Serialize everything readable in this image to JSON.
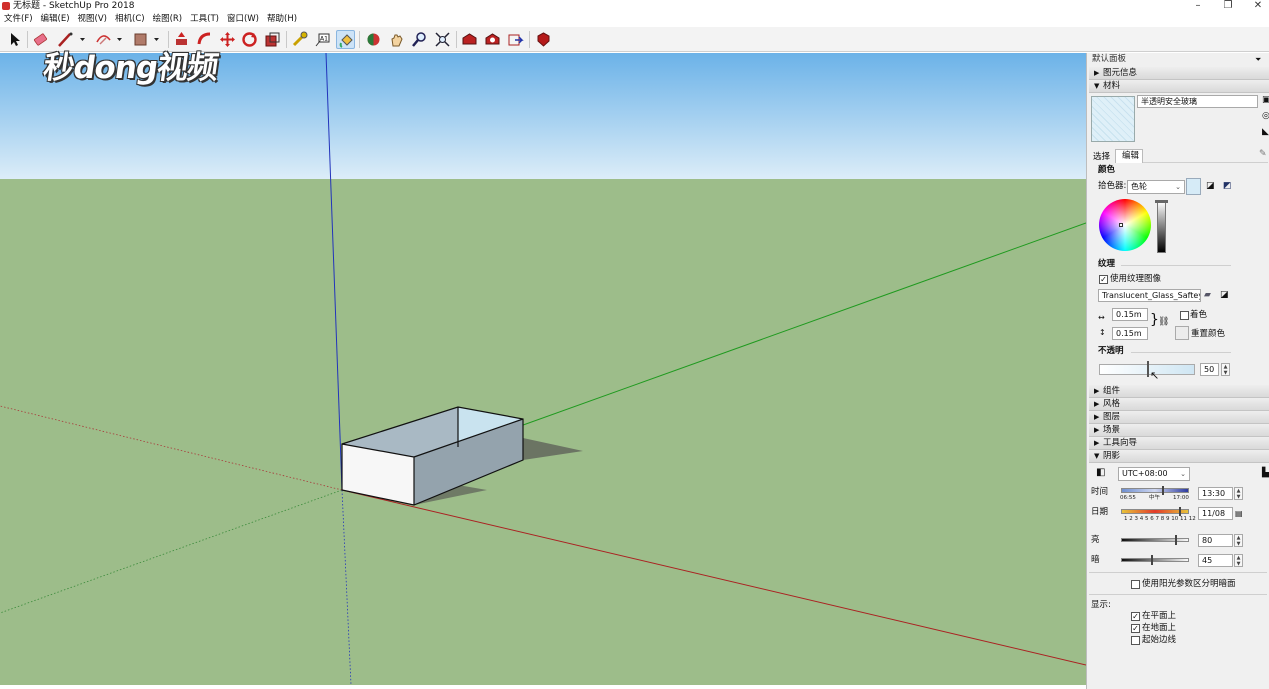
{
  "window": {
    "title": "无标题 - SketchUp Pro 2018",
    "minimize": "–",
    "maximize": "❐",
    "close": "✕"
  },
  "menu": [
    "文件(F)",
    "编辑(E)",
    "视图(V)",
    "相机(C)",
    "绘图(R)",
    "工具(T)",
    "窗口(W)",
    "帮助(H)"
  ],
  "toolbar": {
    "tools": [
      "select-tool",
      "eraser-tool",
      "line-tool",
      "arc-tool",
      "rectangle-tool",
      "pushpull-tool",
      "followme-tool",
      "move-tool",
      "rotate-tool",
      "scale-tool",
      "tape-measure-tool",
      "text-tool",
      "paint-bucket-tool",
      "orbit-tool",
      "pan-tool",
      "zoom-tool",
      "zoom-extents-tool",
      "warehouse-tool",
      "extension-warehouse-tool",
      "send-to-layout-tool",
      "ruby-console-tool"
    ],
    "active": "paint-bucket-tool"
  },
  "watermark": "秒dong视频",
  "panel": {
    "title": "默认面板",
    "sections_top": [
      "图元信息",
      "材料"
    ],
    "material": {
      "name": "半透明安全玻璃",
      "tabs": [
        "选择",
        "编辑"
      ],
      "active_tab": "编辑",
      "color_heading": "颜色",
      "picker_label": "拾色器:",
      "picker_value": "色轮",
      "color_swatch": "#d6ebf7",
      "texture_heading": "纹理",
      "use_texture_label": "使用纹理图像",
      "use_texture_checked": true,
      "texture_file": "Translucent_Glass_Saftey.jpg",
      "width": "0.15m",
      "height": "0.15m",
      "colorize_label": "着色",
      "reset_color_label": "重置颜色",
      "opacity_heading": "不透明",
      "opacity": "50",
      "opacity_fraction": 0.5
    },
    "sections_mid": [
      "组件",
      "风格",
      "图层",
      "场景",
      "工具向导",
      "阴影"
    ],
    "shadow": {
      "timezone": "UTC+08:00",
      "time_label": "时间",
      "time_start": "06:55",
      "time_mid": "中午",
      "time_end": "17:00",
      "time_value": "13:30",
      "date_label": "日期",
      "months": "1 2 3 4 5 6 7 8 9 10 11 12",
      "date_value": "11/08",
      "light_label": "亮",
      "light_value": "80",
      "dark_label": "暗",
      "dark_value": "45",
      "use_sun_label": "使用阳光参数区分明暗面",
      "display_label": "显示:",
      "on_faces_label": "在平面上",
      "on_faces_checked": true,
      "on_ground_label": "在地面上",
      "on_ground_checked": true,
      "from_edges_label": "起始边线",
      "from_edges_checked": false
    }
  },
  "colors": {
    "sky_top": "#6bb2e8",
    "sky_bottom": "#d9ecf7",
    "ground": "#9dbd8a",
    "accent": "#cde3f7"
  }
}
